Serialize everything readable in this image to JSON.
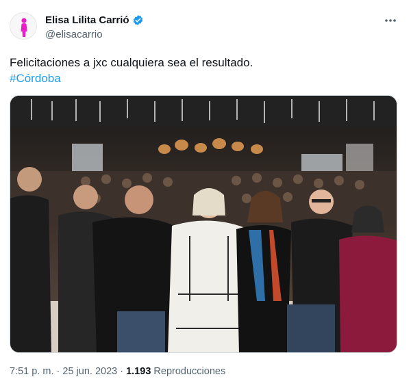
{
  "author": {
    "display_name": "Elisa Lilita Carrió",
    "handle": "@elisacarrio",
    "verified": true,
    "avatar_icon": "person-silhouette-icon",
    "avatar_color": "#e91ec7"
  },
  "tweet": {
    "text": "Felicitaciones a jxc cualquiera sea el resultado.",
    "hashtag": "#Córdoba",
    "media_description_icon": "photo-icon"
  },
  "meta": {
    "time": "7:51 p. m.",
    "separator1": " · ",
    "date": "25 jun. 2023",
    "separator2": " · ",
    "views_count": "1.193",
    "views_label": " Reproducciones"
  },
  "colors": {
    "link": "#1d9bf0",
    "secondary_text": "#536471",
    "primary_text": "#0f1419",
    "verified": "#1d9bf0"
  }
}
